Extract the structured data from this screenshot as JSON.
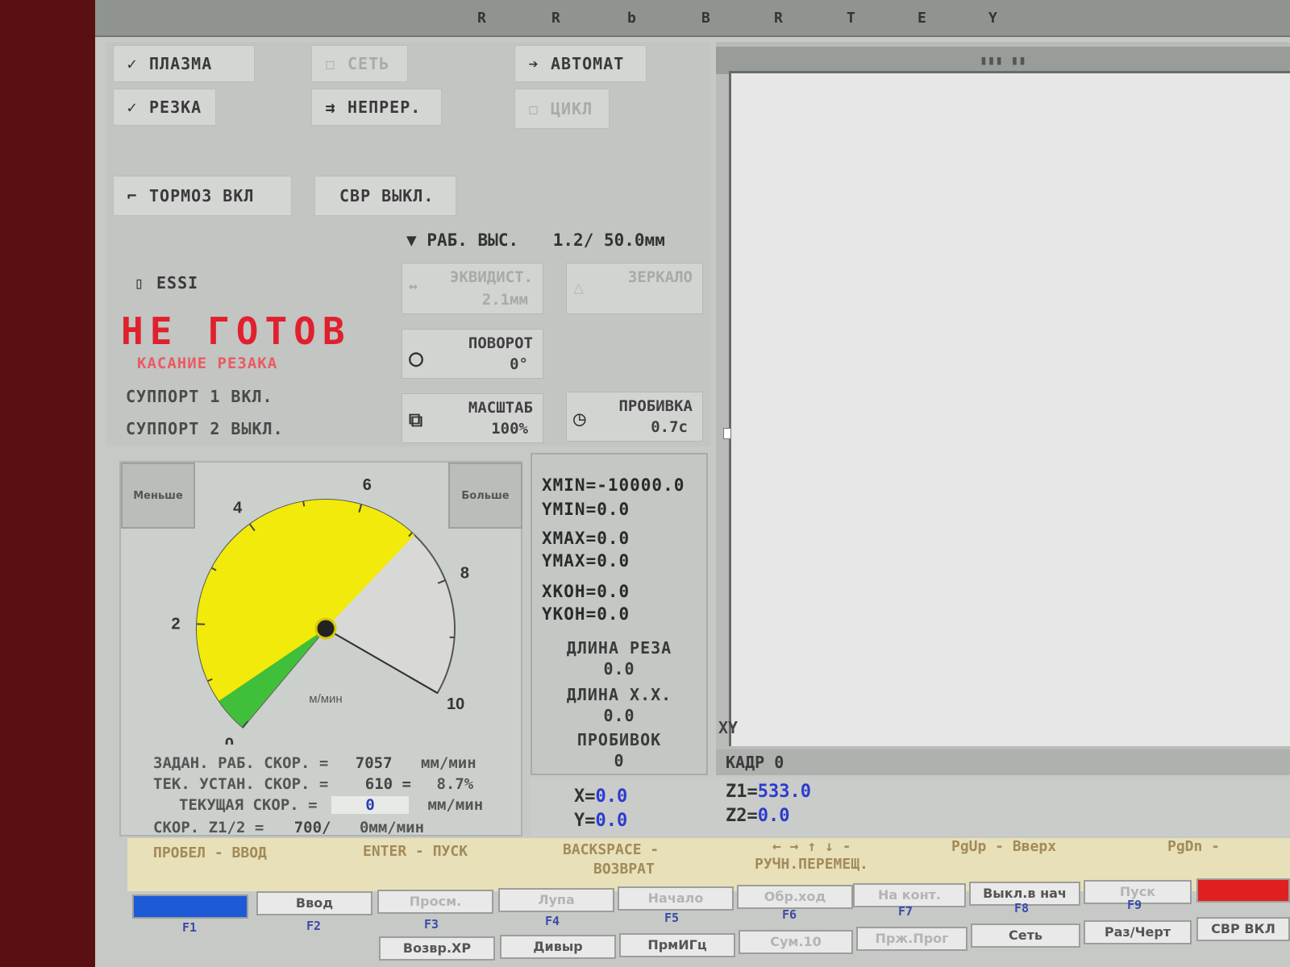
{
  "topbar": {
    "letters": [
      "R",
      "R",
      "b",
      "B",
      "R",
      "T",
      "E",
      "Y"
    ]
  },
  "controls": {
    "plasma": "ПЛАЗМА",
    "cutting": "РЕЗКА",
    "net": "СЕТЬ",
    "continuous": "НЕПРЕР.",
    "auto": "АВТОМАТ",
    "cycle": "ЦИКЛ",
    "brake": "ТОРМОЗ ВКЛ",
    "svr": "СВР ВЫКЛ.",
    "work_height_label": "РАБ. ВЫС.",
    "work_height_value": "1.2/ 50.0мм",
    "essi": "ESSI"
  },
  "status": {
    "title": "НЕ ГОТОВ",
    "subtitle": "КАСАНИЕ РЕЗАКА",
    "support1": "СУППОРТ 1 ВКЛ.",
    "support2": "СУППОРТ 2 ВЫКЛ."
  },
  "params": {
    "equidistant_label": "ЭКВИДИСТ.",
    "equidistant_value": "2.1мм",
    "mirror_label": "ЗЕРКАЛО",
    "rotate_label": "ПОВОРОТ",
    "rotate_value": "0°",
    "scale_label": "МАСШТАБ",
    "scale_value": "100%",
    "pierce_label": "ПРОБИВКА",
    "pierce_value": "0.7с"
  },
  "gauge": {
    "less_button": "Меньше",
    "more_button": "Больше",
    "ticks": [
      "0",
      "2",
      "4",
      "6",
      "8",
      "10"
    ],
    "unit": "м/мин",
    "set_value": 7.057,
    "current_value": 0.61,
    "max": 10
  },
  "speeds": {
    "set_label": "ЗАДАН. РАБ. СКОР. =",
    "set_value": "7057",
    "set_unit": "мм/мин",
    "est_label": "ТЕК. УСТАН. СКОР. =",
    "est_value": "610 =",
    "est_pct": "8.7%",
    "current_label": "ТЕКУЩАЯ СКОР. =",
    "current_value": "0",
    "current_unit": "мм/мин",
    "z_label": "СКОР. Z1/2 =",
    "z_value": "700/",
    "z_unit": "0мм/мин"
  },
  "limits": {
    "xmin": "XMIN=-10000.0",
    "ymin": "YMIN=0.0",
    "xmax": "XMAX=0.0",
    "ymax": "YMAX=0.0",
    "xkon": "XKOH=0.0",
    "ykon": "YKOH=0.0",
    "cut_len_label": "ДЛИНА РЕЗА",
    "cut_len_value": "0.0",
    "idle_len_label": "ДЛИНА Х.Х.",
    "idle_len_value": "0.0",
    "pierces_label": "ПРОБИВОК",
    "pierces_value": "0"
  },
  "coords": {
    "x_label": "X=",
    "x_value": "0.0",
    "y_label": "Y=",
    "y_value": "0.0",
    "z1_label": "Z1=",
    "z1_value": "533.0",
    "z2_label": "Z2=",
    "z2_value": "0.0"
  },
  "view": {
    "kadr": "КАДР 0",
    "axis": "XY"
  },
  "hints": {
    "space": "ПРОБЕЛ - ВВОД",
    "enter": "ENTER - ПУСК",
    "backspace_1": "BACKSPACE -",
    "backspace_2": "ВОЗВРАТ",
    "arrows_1": "← → ↑ ↓ -",
    "arrows_2": "РУЧН.ПЕРЕМЕЩ.",
    "pgup": "PgUp - Вверх",
    "pgdn": "PgDn -"
  },
  "fkeys": {
    "f2": "Ввод",
    "f3": "Просм.",
    "f4": "Лупа",
    "f5": "Начало",
    "f6": "Обр.ход",
    "f7": "На конт.",
    "f8": "Выкл.в нач",
    "f9": "Пуск",
    "r2_f3": "Возвр.ХР",
    "r2_f4": "Дивыр",
    "r2_f5": "ПрмИГц",
    "r2_f6": "Сум.10",
    "r2_f7": "Прж.Прог",
    "r2_f8": "Сеть",
    "r2_f9": "Раз/Черт",
    "r2_f10": "СВР ВКЛ",
    "nums": [
      "F1",
      "F2",
      "F3",
      "F4",
      "F5",
      "F6",
      "F7",
      "F8",
      "F9"
    ]
  }
}
